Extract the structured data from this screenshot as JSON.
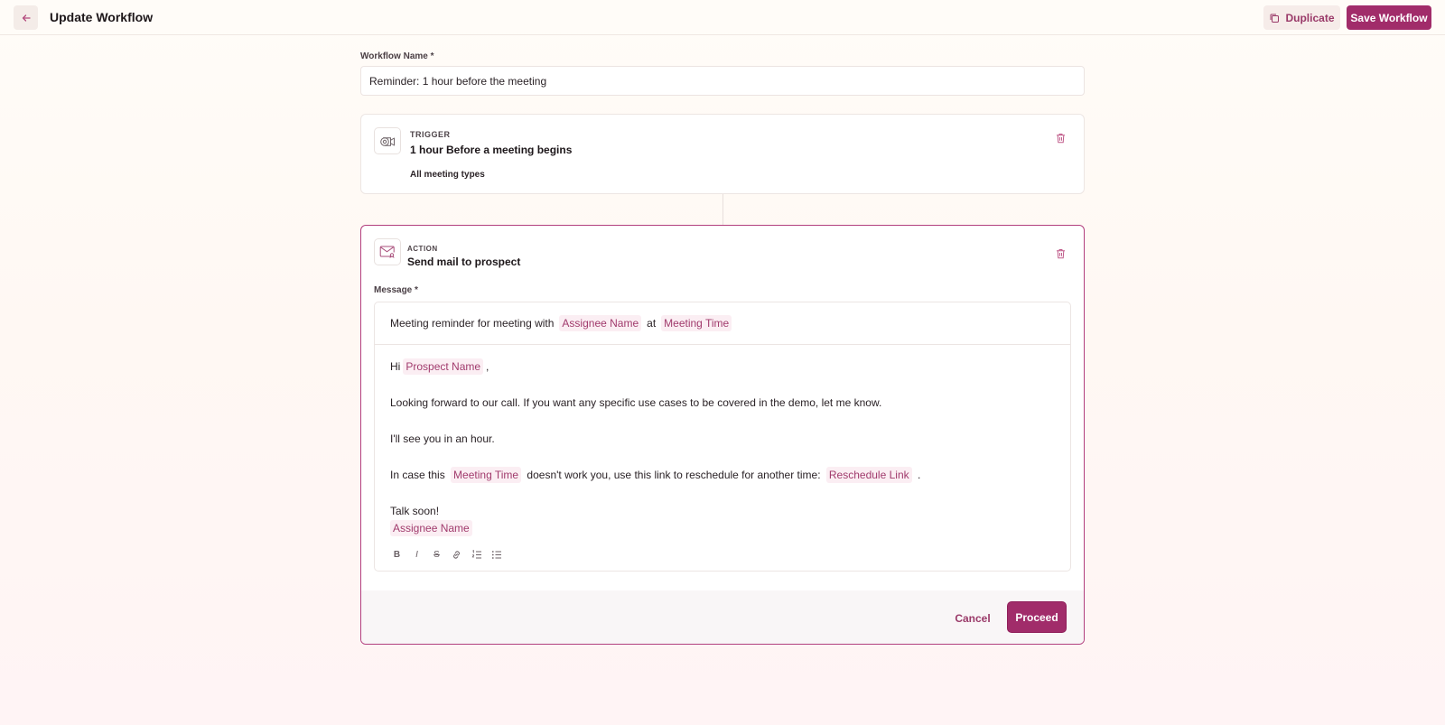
{
  "header": {
    "title": "Update Workflow",
    "duplicate_label": "Duplicate",
    "save_label": "Save Workflow"
  },
  "workflow_name": {
    "label": "Workflow Name *",
    "value": "Reminder: 1 hour before the meeting"
  },
  "trigger": {
    "kicker": "TRIGGER",
    "title": "1 hour Before a meeting begins",
    "subtitle": "All meeting types"
  },
  "action": {
    "kicker": "ACTION",
    "title": "Send mail to prospect",
    "message_label": "Message *",
    "subject": {
      "prefix": "Meeting reminder for meeting with",
      "tag1": "Assignee Name",
      "middle": "at",
      "tag2": "Meeting Time"
    },
    "body": {
      "greeting": "Hi",
      "greeting_tag": "Prospect Name",
      "greeting_suffix": ",",
      "line1": "Looking forward to our call. If you want any specific use cases to be covered in the demo, let me know.",
      "line2": "I'll see you in an hour.",
      "line3_prefix": "In case this",
      "line3_tag1": "Meeting Time",
      "line3_middle": "doesn't work you, use this link to reschedule for another time:",
      "line3_tag2": "Reschedule Link",
      "line3_suffix": ".",
      "signoff": "Talk soon!",
      "signature_tag": "Assignee Name"
    },
    "toolbar": {
      "bold": "B",
      "italic": "I",
      "strike": "S"
    },
    "cancel_label": "Cancel",
    "proceed_label": "Proceed"
  },
  "colors": {
    "accent": "#a12c6a",
    "accent_text": "#9a3a69",
    "tag_bg": "#fbeef3"
  }
}
